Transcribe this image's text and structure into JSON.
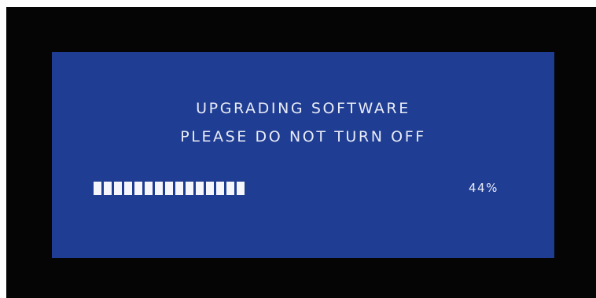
{
  "screen": {
    "title": "UPGRADING SOFTWARE",
    "warning": "PLEASE DO NOT TURN OFF",
    "progress": {
      "value_percent": 44,
      "label": "44%",
      "segments_filled": 15
    },
    "colors": {
      "screen_background": "#1f3d92",
      "frame": "#050505",
      "text": "#e9ecf7",
      "progress_segment": "#f4f6fb"
    }
  }
}
